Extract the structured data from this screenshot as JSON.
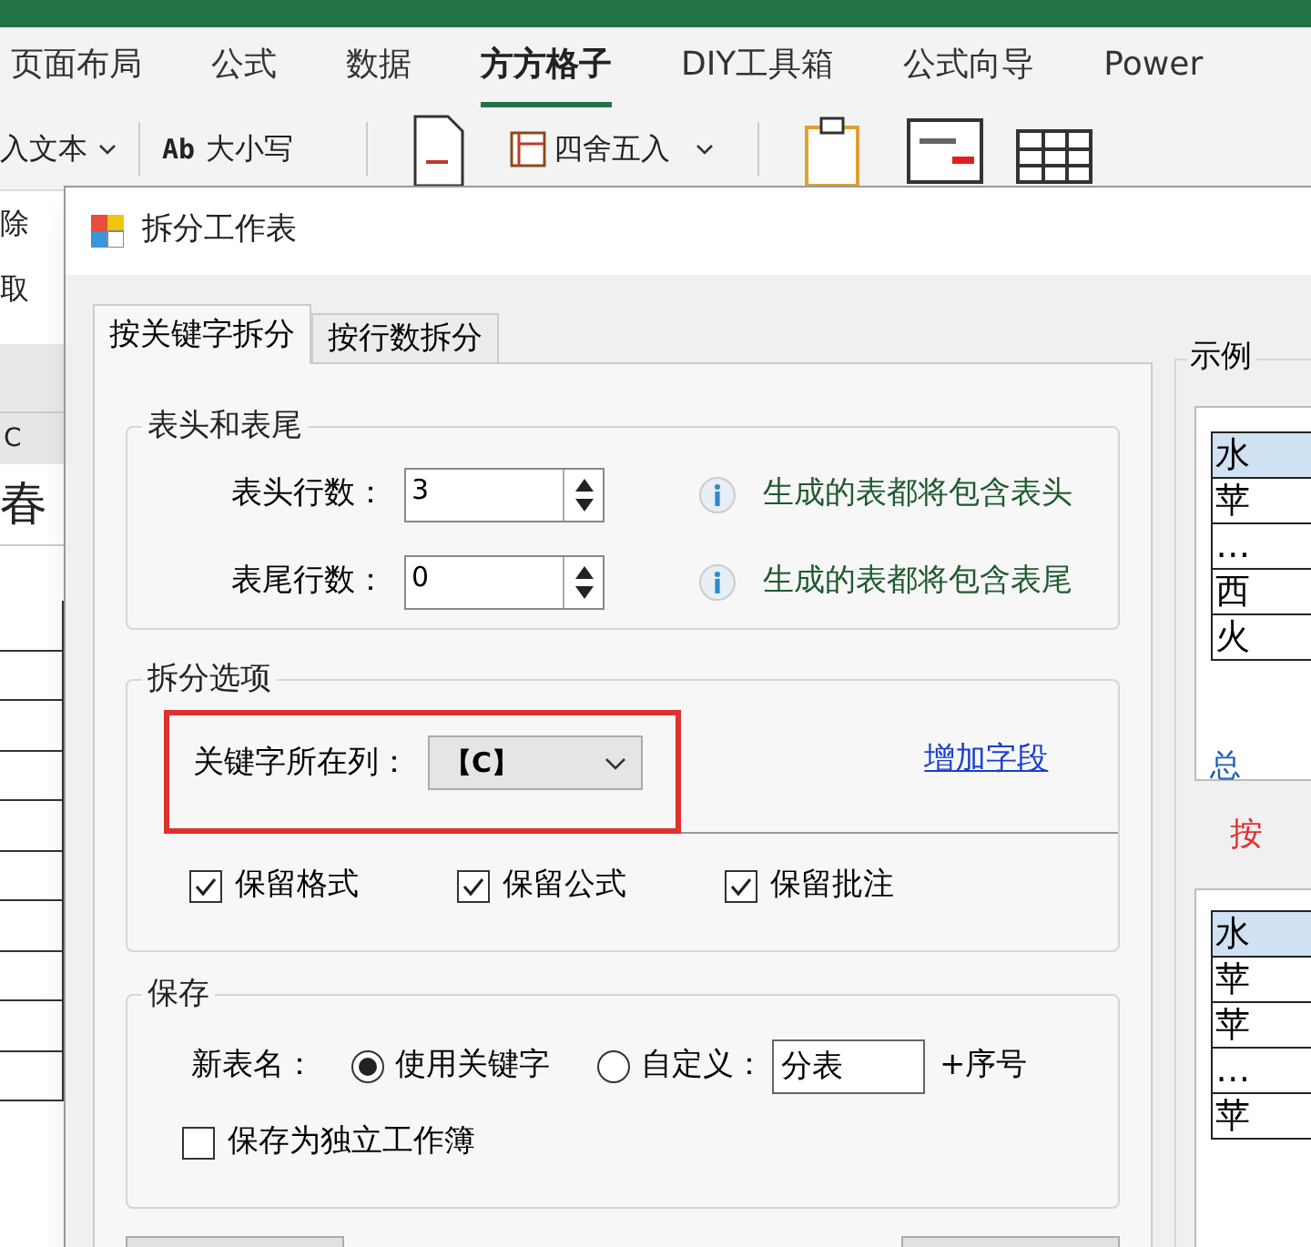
{
  "ribbon": {
    "tabs": [
      {
        "label": "页面布局",
        "selected": false
      },
      {
        "label": "公式",
        "selected": false
      },
      {
        "label": "数据",
        "selected": false
      },
      {
        "label": "方方格子",
        "selected": true
      },
      {
        "label": "DIY工具箱",
        "selected": false
      },
      {
        "label": "公式向导",
        "selected": false
      },
      {
        "label": "Power",
        "selected": false
      }
    ]
  },
  "toolbar": {
    "insert_text": "入文本",
    "case_icon_text": "Ab",
    "case_label": "大小写",
    "round_label": "四舍五入"
  },
  "sheet": {
    "side_labels": [
      "除",
      "取"
    ],
    "column_header": "C",
    "title_cell": "春"
  },
  "dialog": {
    "title": "拆分工作表",
    "tabs": [
      {
        "label": "按关键字拆分",
        "selected": true
      },
      {
        "label": "按行数拆分",
        "selected": false
      }
    ],
    "header_footer": {
      "title": "表头和表尾",
      "rows": [
        {
          "label": "表头行数：",
          "value": "3",
          "hint": "生成的表都将包含表头"
        },
        {
          "label": "表尾行数：",
          "value": "0",
          "hint": "生成的表都将包含表尾"
        }
      ]
    },
    "split_options": {
      "title": "拆分选项",
      "key_column_label": "关键字所在列：",
      "key_column_value": "【C】",
      "add_field_link": "增加字段",
      "checkboxes": [
        {
          "label": "保留格式",
          "checked": true
        },
        {
          "label": "保留公式",
          "checked": true
        },
        {
          "label": "保留批注",
          "checked": true
        }
      ]
    },
    "save": {
      "title": "保存",
      "name_label": "新表名：",
      "radios": [
        {
          "label": "使用关键字",
          "selected": true
        },
        {
          "label": "自定义：",
          "selected": false
        }
      ],
      "custom_value": "分表",
      "suffix": "+序号",
      "standalone": {
        "label": "保存为独立工作簿",
        "checked": false
      }
    },
    "example": {
      "title": "示例",
      "table1": [
        "水",
        "苹",
        "…",
        "西",
        "火"
      ],
      "table1_caption": "总",
      "note": "按",
      "table2": [
        "水",
        "苹",
        "苹",
        "…",
        "苹"
      ]
    }
  }
}
